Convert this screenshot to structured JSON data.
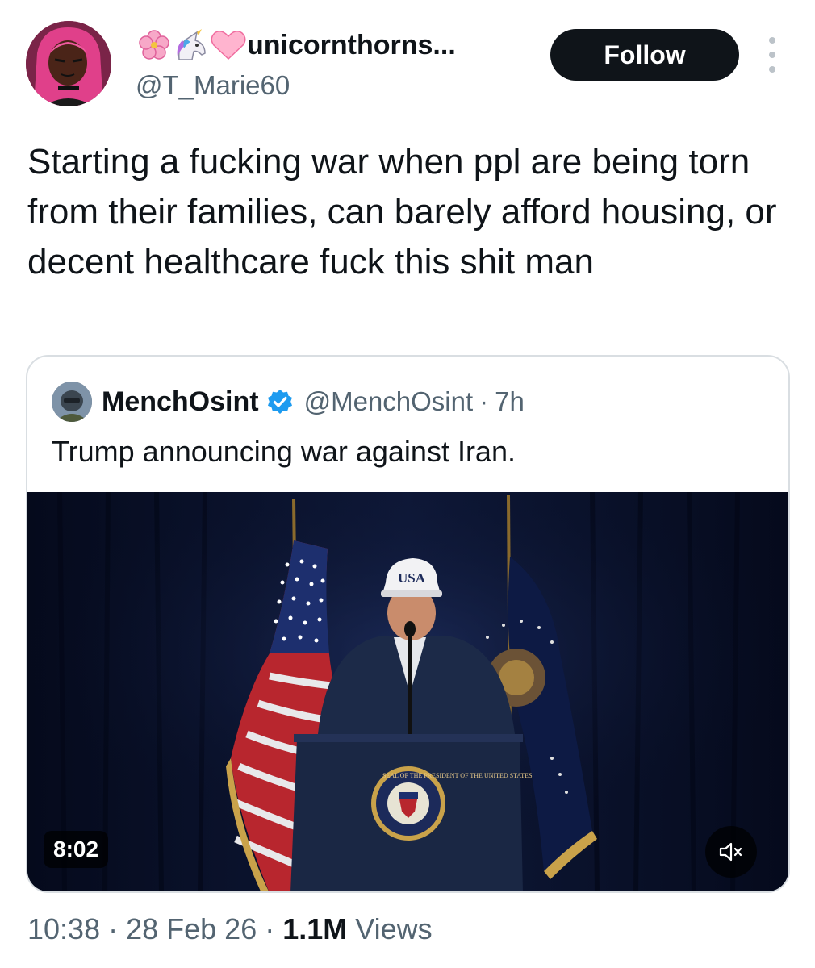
{
  "author": {
    "display_name": "unicornthorns...",
    "handle": "@T_Marie60",
    "name_emojis": [
      "cherry-blossom-icon",
      "unicorn-icon",
      "pink-heart-icon"
    ],
    "follow_label": "Follow"
  },
  "tweet": {
    "text": "Starting a fucking war when ppl are being torn from their families, can barely afford housing, or decent healthcare fuck this shit man"
  },
  "quoted": {
    "display_name": "MenchOsint",
    "handle": "@MenchOsint",
    "separator": "·",
    "time": "7h",
    "text": "Trump announcing war against Iran.",
    "video_duration": "8:02",
    "cap_text": "USA",
    "seal_text": "SEAL OF THE PRESIDENT OF THE UNITED STATES"
  },
  "meta": {
    "time": "10:38",
    "separator": "·",
    "date": "28 Feb 26",
    "views_count": "1.1M",
    "views_label": "Views"
  },
  "colors": {
    "text_primary": "#0f1419",
    "text_secondary": "#536471",
    "verified_blue": "#1d9bf0",
    "border": "#d9dee2",
    "follow_bg": "#0f1419"
  }
}
